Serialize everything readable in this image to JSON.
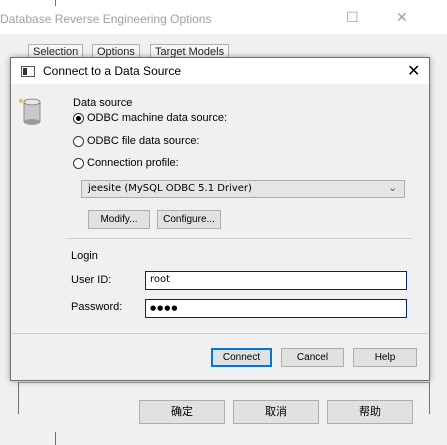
{
  "background_window": {
    "title": "Database Reverse Engineering Options",
    "tabs": [
      "Selection",
      "Options",
      "Target Models"
    ],
    "buttons": {
      "ok": "确定",
      "cancel": "取消",
      "help": "帮助"
    }
  },
  "dialog": {
    "title": "Connect to a Data Source",
    "close_glyph": "✕",
    "data_source": {
      "group_label": "Data source",
      "odbc_machine": "ODBC machine data source:",
      "odbc_file": "ODBC file data source:",
      "connection_profile": "Connection profile:",
      "selected_option": "odbc_machine"
    },
    "dsn_select": {
      "value": "jeesite (MySQL ODBC 5.1 Driver)"
    },
    "modify_label": "Modify...",
    "configure_label": "Configure...",
    "login": {
      "group_label": "Login",
      "user_id_label": "User ID:",
      "user_id_value": "root",
      "password_label": "Password:",
      "password_value": "●●●●"
    },
    "buttons": {
      "connect": "Connect",
      "cancel": "Cancel",
      "help": "Help"
    }
  }
}
